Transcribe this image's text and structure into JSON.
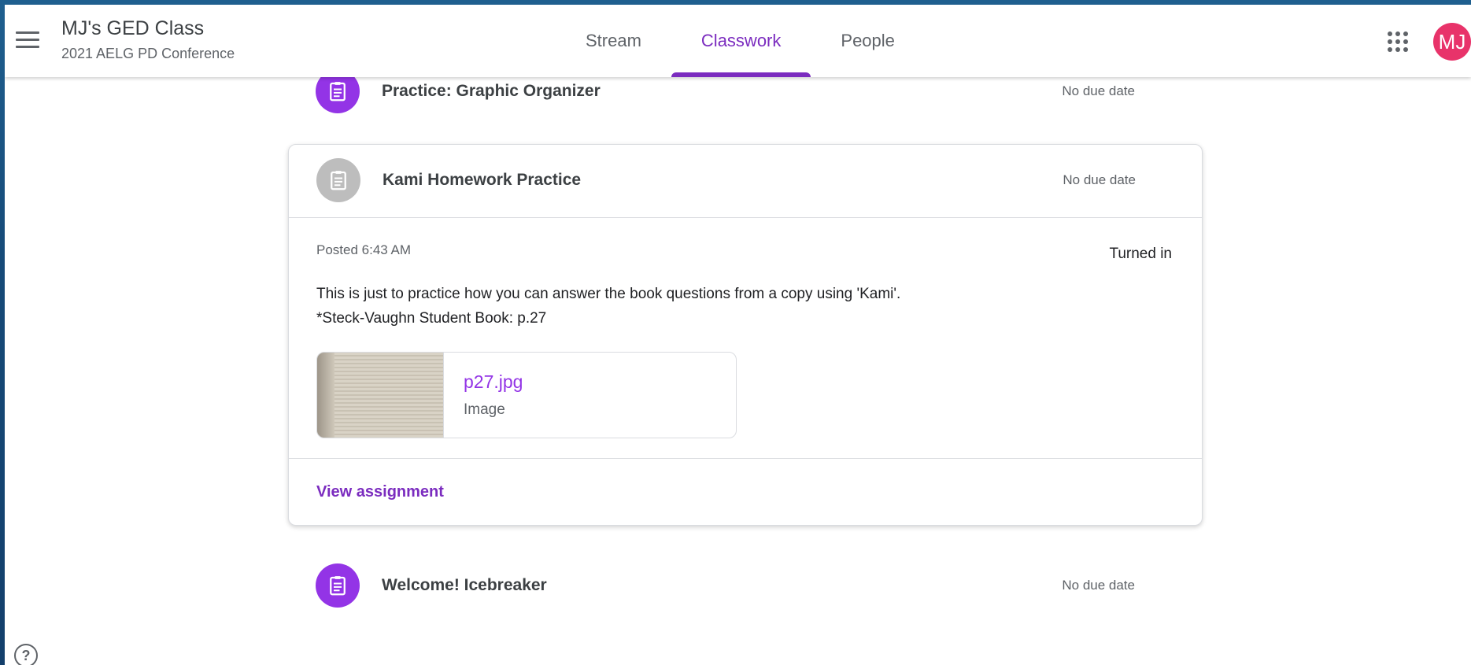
{
  "header": {
    "class_name": "MJ's GED Class",
    "class_section": "2021 AELG PD Conference",
    "tabs": [
      {
        "label": "Stream",
        "active": false
      },
      {
        "label": "Classwork",
        "active": true
      },
      {
        "label": "People",
        "active": false
      }
    ],
    "avatar_initials": "MJ",
    "accent_color": "#7b2cbf"
  },
  "classwork": {
    "items": [
      {
        "title": "Practice: Graphic Organizer",
        "due": "No due date",
        "icon": "assignment-icon"
      },
      {
        "title": "Kami Homework Practice",
        "due": "No due date",
        "icon": "assignment-icon",
        "expanded": true,
        "posted": "Posted 6:43 AM",
        "status": "Turned in",
        "description_line1": "This is just to practice how you can answer the book questions from a copy using 'Kami'.",
        "description_line2": "*Steck-Vaughn Student Book: p.27",
        "attachment": {
          "name": "p27.jpg",
          "type": "Image"
        },
        "view_label": "View assignment"
      },
      {
        "title": "Welcome! Icebreaker",
        "due": "No due date",
        "icon": "assignment-icon"
      }
    ]
  },
  "help_icon": "help-icon"
}
